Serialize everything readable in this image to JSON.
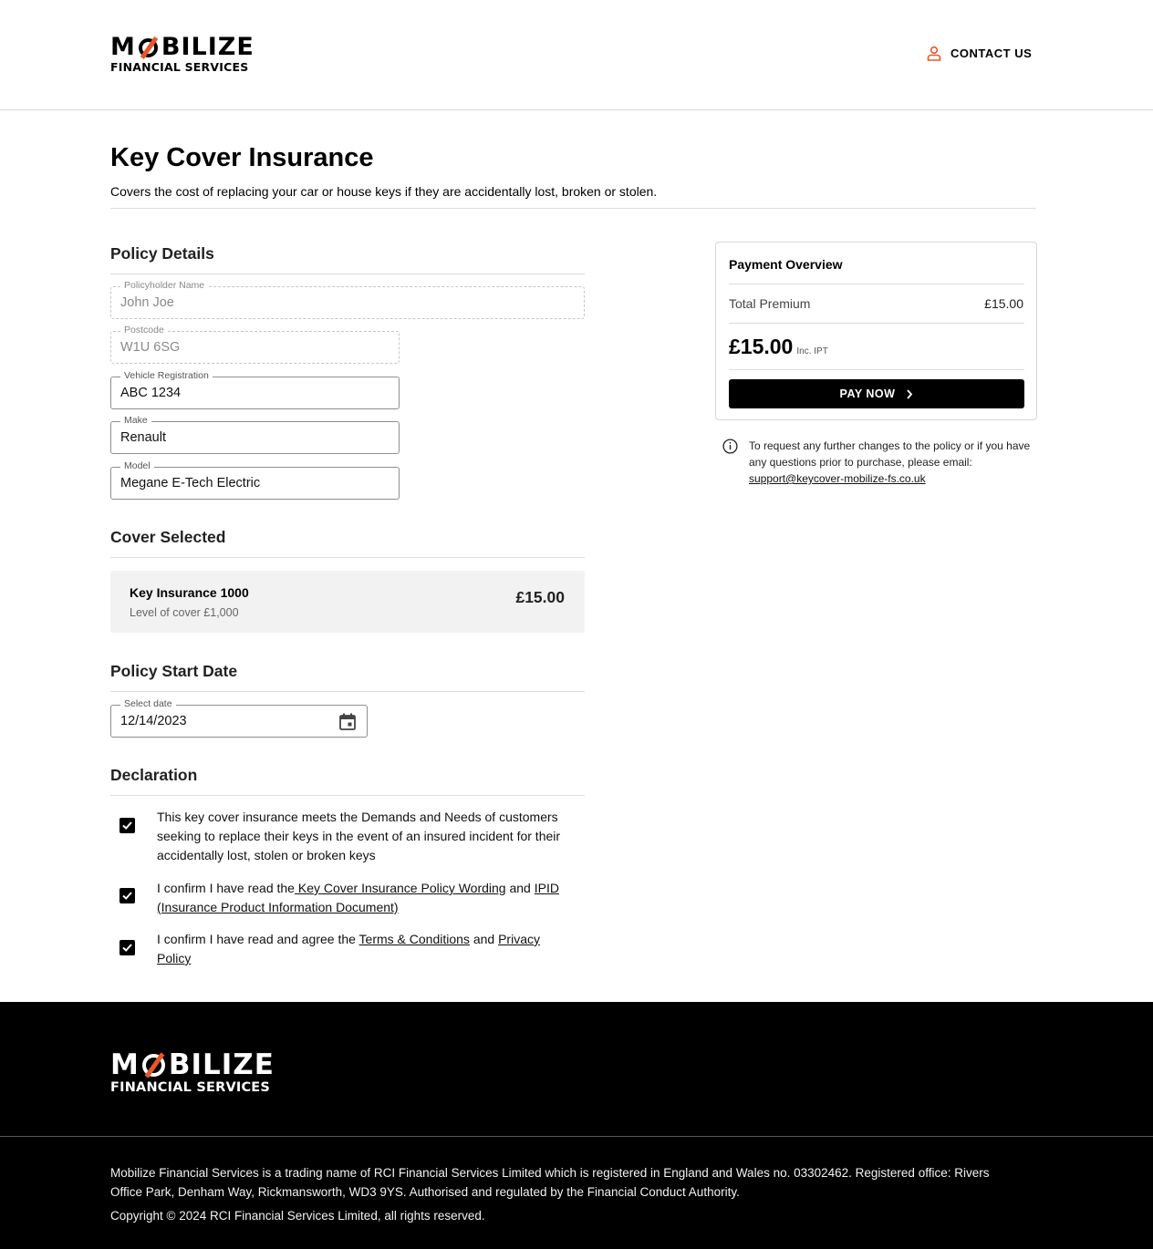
{
  "brand": {
    "logo_top_pre": "M",
    "logo_top_post": "BILIZE",
    "logo_bottom": "FINANCIAL SERVICES",
    "accent_color": "#e8562a"
  },
  "header": {
    "contact_label": "CONTACT US",
    "contact_icon": "user-icon"
  },
  "page": {
    "title": "Key Cover Insurance",
    "subtitle": "Covers the cost of replacing your car or house keys if they are accidentally lost, broken or stolen."
  },
  "policy_details": {
    "heading": "Policy Details",
    "fields": {
      "policyholder": {
        "label": "Policyholder Name",
        "value": "John Joe"
      },
      "postcode": {
        "label": "Postcode",
        "value": "W1U 6SG"
      },
      "registration": {
        "label": "Vehicle Registration",
        "value": "ABC 1234"
      },
      "make": {
        "label": "Make",
        "value": "Renault"
      },
      "model": {
        "label": "Model",
        "value": "Megane E-Tech Electric"
      }
    }
  },
  "cover": {
    "heading": "Cover Selected",
    "name": "Key Insurance 1000",
    "level": "Level of cover £1,000",
    "price": "£15.00"
  },
  "start_date": {
    "heading": "Policy Start Date",
    "label": "Select date",
    "value": "12/14/2023"
  },
  "declaration": {
    "heading": "Declaration",
    "item1": "This key cover insurance meets the Demands and Needs of customers seeking to replace their keys in the event of an insured incident for their accidentally lost, stolen or broken keys",
    "item2_pre": "I confirm I have read the",
    "item2_link1": " Key Cover Insurance Policy Wording",
    "item2_mid": " and ",
    "item2_link2": "IPID (Insurance Product Information Document)",
    "item3_pre": "I confirm I have read and agree the ",
    "item3_link1": "Terms & Conditions",
    "item3_mid": " and ",
    "item3_link2": "Privacy Policy",
    "checked": [
      true,
      true,
      true
    ]
  },
  "payment": {
    "title": "Payment Overview",
    "premium_label": "Total Premium",
    "premium_value": "£15.00",
    "total": "£15.00",
    "total_note": "Inc. IPT",
    "button_label": "PAY NOW"
  },
  "info": {
    "text": "To request any further changes to the policy or if you have any questions prior to purchase, please email:",
    "email": "support@keycover-mobilize-fs.co.uk"
  },
  "footer": {
    "legal": "Mobilize Financial Services is a trading name of RCI Financial Services Limited which is registered in England and Wales no. 03302462. Registered office: Rivers Office Park, Denham Way, Rickmansworth, WD3 9YS. Authorised and regulated by the Financial Conduct Authority.",
    "copyright": "Copyright © 2024 RCI Financial Services Limited, all rights reserved."
  }
}
